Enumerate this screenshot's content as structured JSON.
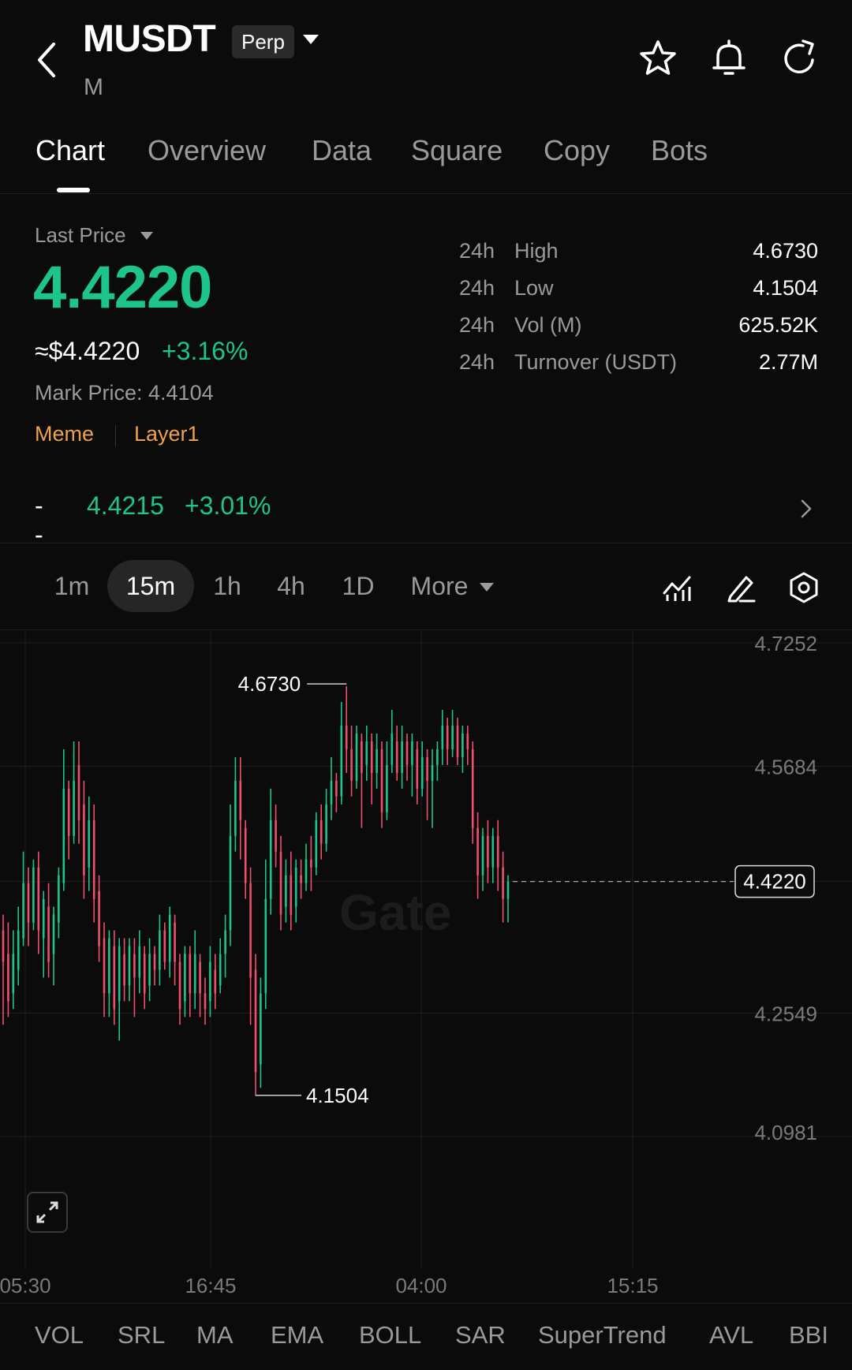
{
  "header": {
    "symbol": "MUSDT",
    "sub_symbol": "M",
    "contract_type": "Perp",
    "icons": [
      "back-icon",
      "star-icon",
      "bell-icon",
      "refresh-icon"
    ]
  },
  "tabs": [
    {
      "label": "Chart",
      "active": true
    },
    {
      "label": "Overview",
      "active": false
    },
    {
      "label": "Data",
      "active": false
    },
    {
      "label": "Square",
      "active": false
    },
    {
      "label": "Copy",
      "active": false
    },
    {
      "label": "Bots",
      "active": false
    }
  ],
  "price": {
    "label": "Last Price",
    "last": "4.4220",
    "usd": "≈$4.4220",
    "change_pct": "+3.16%",
    "mark_price": "Mark Price: 4.4104",
    "tags": [
      "Meme",
      "Layer1"
    ],
    "index_dash": "--",
    "index_price": "4.4215",
    "index_pct": "+3.01%"
  },
  "stats": [
    {
      "prefix": "24h",
      "label": "High",
      "value": "4.6730"
    },
    {
      "prefix": "24h",
      "label": "Low",
      "value": "4.1504"
    },
    {
      "prefix": "24h",
      "label": "Vol (M)",
      "value": "625.52K"
    },
    {
      "prefix": "24h",
      "label": "Turnover (USDT)",
      "value": "2.77M"
    }
  ],
  "timeframes": {
    "items": [
      "1m",
      "15m",
      "1h",
      "4h",
      "1D"
    ],
    "active": "15m",
    "more_label": "More"
  },
  "colors": {
    "up": "#1dc48b",
    "down": "#f0506e",
    "accent_tag": "#f0a04b",
    "background": "#0b0b0b"
  },
  "chart_data": {
    "type": "candlestick",
    "watermark": "Gate",
    "y_ticks": [
      "4.7252",
      "4.5684",
      "4.4220",
      "4.2549",
      "4.0981"
    ],
    "ylim": [
      4.0981,
      4.7252
    ],
    "x_ticks": [
      "05:30",
      "16:45",
      "04:00",
      "15:15"
    ],
    "high_label": "4.6730",
    "low_label": "4.1504",
    "current_price": 4.422,
    "current_label": "4.4220",
    "grid": true,
    "candles": [
      [
        4.36,
        4.32,
        4.38,
        4.24
      ],
      [
        4.33,
        4.27,
        4.37,
        4.25
      ],
      [
        4.28,
        4.33,
        4.36,
        4.26
      ],
      [
        4.31,
        4.36,
        4.39,
        4.29
      ],
      [
        4.35,
        4.42,
        4.46,
        4.34
      ],
      [
        4.42,
        4.37,
        4.44,
        4.34
      ],
      [
        4.37,
        4.44,
        4.45,
        4.36
      ],
      [
        4.44,
        4.36,
        4.46,
        4.33
      ],
      [
        4.35,
        4.4,
        4.41,
        4.3
      ],
      [
        4.39,
        4.32,
        4.42,
        4.3
      ],
      [
        4.33,
        4.38,
        4.39,
        4.29
      ],
      [
        4.37,
        4.43,
        4.44,
        4.35
      ],
      [
        4.42,
        4.54,
        4.59,
        4.41
      ],
      [
        4.54,
        4.48,
        4.55,
        4.45
      ],
      [
        4.48,
        4.55,
        4.6,
        4.47
      ],
      [
        4.57,
        4.5,
        4.6,
        4.47
      ],
      [
        4.52,
        4.43,
        4.55,
        4.4
      ],
      [
        4.44,
        4.5,
        4.53,
        4.41
      ],
      [
        4.5,
        4.4,
        4.52,
        4.37
      ],
      [
        4.41,
        4.34,
        4.43,
        4.32
      ],
      [
        4.35,
        4.28,
        4.37,
        4.25
      ],
      [
        4.28,
        4.35,
        4.36,
        4.25
      ],
      [
        4.34,
        4.26,
        4.36,
        4.24
      ],
      [
        4.27,
        4.34,
        4.35,
        4.22
      ],
      [
        4.33,
        4.29,
        4.35,
        4.27
      ],
      [
        4.29,
        4.34,
        4.35,
        4.27
      ],
      [
        4.33,
        4.3,
        4.35,
        4.25
      ],
      [
        4.3,
        4.34,
        4.36,
        4.28
      ],
      [
        4.33,
        4.28,
        4.34,
        4.26
      ],
      [
        4.29,
        4.33,
        4.35,
        4.27
      ],
      [
        4.33,
        4.31,
        4.34,
        4.29
      ],
      [
        4.31,
        4.36,
        4.38,
        4.29
      ],
      [
        4.36,
        4.32,
        4.37,
        4.31
      ],
      [
        4.32,
        4.38,
        4.39,
        4.3
      ],
      [
        4.37,
        4.32,
        4.38,
        4.29
      ],
      [
        4.32,
        4.26,
        4.33,
        4.24
      ],
      [
        4.27,
        4.33,
        4.34,
        4.25
      ],
      [
        4.33,
        4.28,
        4.34,
        4.25
      ],
      [
        4.28,
        4.33,
        4.36,
        4.26
      ],
      [
        4.32,
        4.28,
        4.33,
        4.25
      ],
      [
        4.28,
        4.26,
        4.3,
        4.24
      ],
      [
        4.27,
        4.32,
        4.34,
        4.25
      ],
      [
        4.31,
        4.28,
        4.33,
        4.26
      ],
      [
        4.29,
        4.33,
        4.35,
        4.28
      ],
      [
        4.33,
        4.36,
        4.38,
        4.3
      ],
      [
        4.36,
        4.48,
        4.52,
        4.34
      ],
      [
        4.48,
        4.55,
        4.58,
        4.46
      ],
      [
        4.55,
        4.5,
        4.58,
        4.45
      ],
      [
        4.49,
        4.42,
        4.5,
        4.4
      ],
      [
        4.42,
        4.3,
        4.44,
        4.24
      ],
      [
        4.31,
        4.18,
        4.33,
        4.15
      ],
      [
        4.19,
        4.28,
        4.3,
        4.16
      ],
      [
        4.28,
        4.4,
        4.45,
        4.26
      ],
      [
        4.4,
        4.5,
        4.54,
        4.38
      ],
      [
        4.5,
        4.46,
        4.52,
        4.44
      ],
      [
        4.46,
        4.38,
        4.48,
        4.36
      ],
      [
        4.39,
        4.43,
        4.45,
        4.37
      ],
      [
        4.43,
        4.38,
        4.46,
        4.36
      ],
      [
        4.39,
        4.44,
        4.45,
        4.37
      ],
      [
        4.43,
        4.42,
        4.45,
        4.4
      ],
      [
        4.42,
        4.45,
        4.47,
        4.41
      ],
      [
        4.45,
        4.44,
        4.48,
        4.41
      ],
      [
        4.44,
        4.5,
        4.51,
        4.43
      ],
      [
        4.5,
        4.47,
        4.52,
        4.45
      ],
      [
        4.47,
        4.52,
        4.54,
        4.46
      ],
      [
        4.52,
        4.55,
        4.58,
        4.5
      ],
      [
        4.55,
        4.53,
        4.56,
        4.51
      ],
      [
        4.53,
        4.62,
        4.65,
        4.52
      ],
      [
        4.62,
        4.59,
        4.67,
        4.56
      ],
      [
        4.59,
        4.55,
        4.62,
        4.53
      ],
      [
        4.55,
        4.61,
        4.62,
        4.54
      ],
      [
        4.6,
        4.56,
        4.61,
        4.49
      ],
      [
        4.57,
        4.6,
        4.62,
        4.55
      ],
      [
        4.6,
        4.56,
        4.61,
        4.52
      ],
      [
        4.56,
        4.59,
        4.61,
        4.54
      ],
      [
        4.59,
        4.51,
        4.6,
        4.49
      ],
      [
        4.51,
        4.57,
        4.6,
        4.5
      ],
      [
        4.57,
        4.61,
        4.64,
        4.56
      ],
      [
        4.6,
        4.56,
        4.62,
        4.55
      ],
      [
        4.56,
        4.6,
        4.62,
        4.54
      ],
      [
        4.6,
        4.57,
        4.61,
        4.55
      ],
      [
        4.57,
        4.6,
        4.61,
        4.53
      ],
      [
        4.59,
        4.54,
        4.6,
        4.52
      ],
      [
        4.54,
        4.58,
        4.6,
        4.53
      ],
      [
        4.58,
        4.55,
        4.59,
        4.5
      ],
      [
        4.55,
        4.57,
        4.59,
        4.49
      ],
      [
        4.57,
        4.59,
        4.6,
        4.55
      ],
      [
        4.59,
        4.62,
        4.64,
        4.57
      ],
      [
        4.62,
        4.59,
        4.63,
        4.57
      ],
      [
        4.59,
        4.62,
        4.64,
        4.58
      ],
      [
        4.62,
        4.58,
        4.63,
        4.57
      ],
      [
        4.58,
        4.61,
        4.62,
        4.56
      ],
      [
        4.61,
        4.59,
        4.62,
        4.57
      ],
      [
        4.59,
        4.49,
        4.6,
        4.47
      ],
      [
        4.49,
        4.43,
        4.51,
        4.4
      ],
      [
        4.43,
        4.48,
        4.49,
        4.41
      ],
      [
        4.48,
        4.44,
        4.5,
        4.42
      ],
      [
        4.44,
        4.48,
        4.49,
        4.42
      ],
      [
        4.48,
        4.44,
        4.5,
        4.41
      ],
      [
        4.44,
        4.4,
        4.46,
        4.37
      ],
      [
        4.4,
        4.422,
        4.43,
        4.37
      ]
    ]
  },
  "indicators": [
    "VOL",
    "SRL",
    "MA",
    "EMA",
    "BOLL",
    "SAR",
    "SuperTrend",
    "AVL",
    "BBI"
  ]
}
